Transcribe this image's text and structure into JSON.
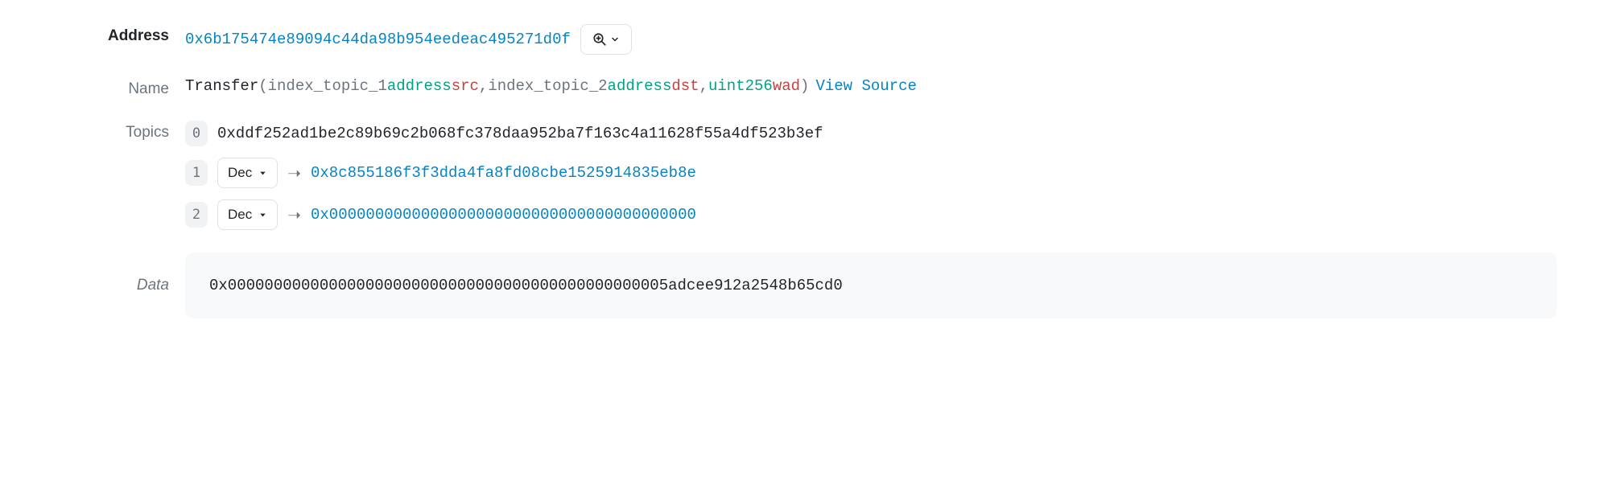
{
  "labels": {
    "address": "Address",
    "name": "Name",
    "topics": "Topics",
    "data": "Data"
  },
  "address": {
    "value": "0x6b175474e89094c44da98b954eedeac495271d0f"
  },
  "name": {
    "event": "Transfer",
    "open_paren": " (",
    "p0_idx": "index_topic_1 ",
    "p0_type": "address ",
    "p0_name": "src",
    "sep0": ", ",
    "p1_idx": "index_topic_2 ",
    "p1_type": "address ",
    "p1_name": "dst",
    "sep1": ", ",
    "p2_type": "uint256 ",
    "p2_name": "wad",
    "close_paren": ")",
    "view_source": "View Source"
  },
  "topics": {
    "t0_idx": "0",
    "t0_hash": "0xddf252ad1be2c89b69c2b068fc378daa952ba7f163c4a11628f55a4df523b3ef",
    "t1_idx": "1",
    "t1_fmt": "Dec",
    "t1_val": "0x8c855186f3f3dda4fa8fd08cbe1525914835eb8e",
    "t2_idx": "2",
    "t2_fmt": "Dec",
    "t2_val": "0x0000000000000000000000000000000000000000"
  },
  "data": {
    "value": "0x000000000000000000000000000000000000000000000005adcee912a2548b65cd0"
  }
}
